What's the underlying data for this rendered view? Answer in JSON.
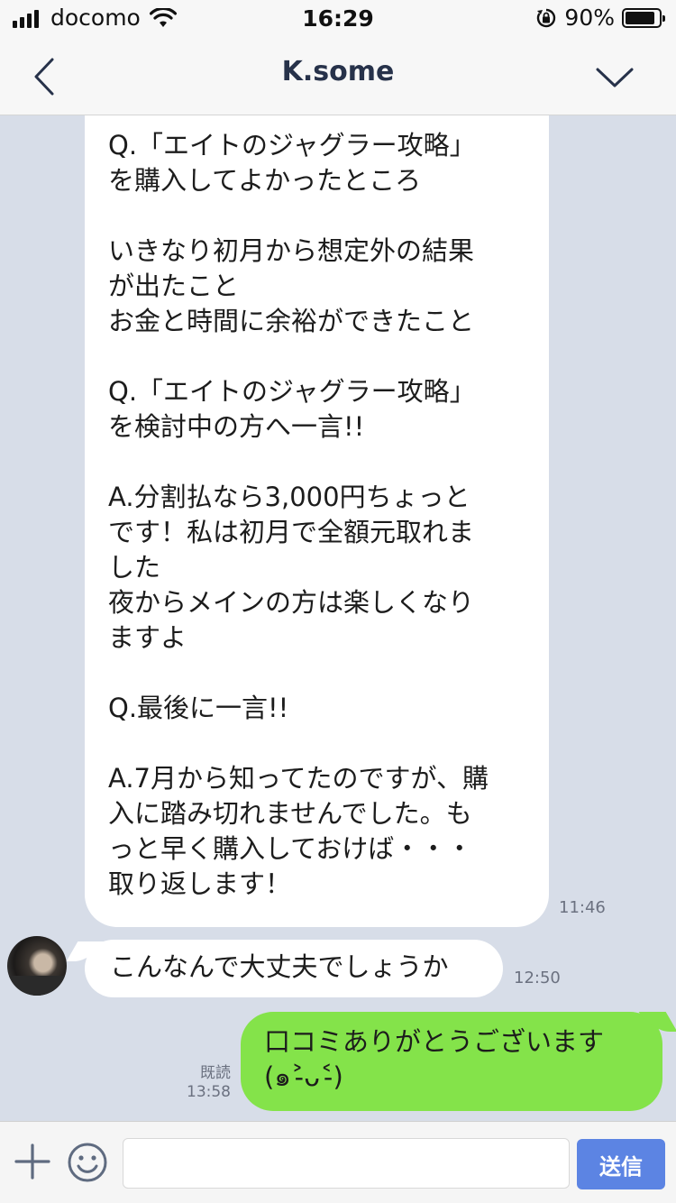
{
  "status_bar": {
    "carrier": "docomo",
    "time": "16:29",
    "battery_percent": "90%",
    "battery_level": 0.9,
    "icons": [
      "signal-icon",
      "wifi-icon",
      "orientation-lock-icon",
      "battery-icon"
    ]
  },
  "header": {
    "title": "K.some",
    "back_icon": "chevron-left-icon",
    "menu_icon": "chevron-down-icon"
  },
  "messages": [
    {
      "direction": "incoming",
      "text": "Q.「エイトのジャグラー攻略」\nを購入してよかったところ\n\nいきなり初月から想定外の結果\nが出たこと\nお金と時間に余裕ができたこと\n\nQ.「エイトのジャグラー攻略」\nを検討中の方へ一言!!\n\nA.分割払なら3,000円ちょっと\nです！私は初月で全額元取れま\nした\n夜からメインの方は楽しくなり\nますよ\n\nQ.最後に一言!!\n\nA.7月から知ってたのですが、購\n入に踏み切れませんでした。も\nっと早く購入しておけば・・・\n取り返します！",
      "time": "11:46"
    },
    {
      "direction": "incoming",
      "text": "こんなんで大丈夫でしょうか",
      "time": "12:50"
    },
    {
      "direction": "outgoing",
      "text_line1": "口コミありがとうございます",
      "text_line2": "(๑˃̵ᴗ˂̵)",
      "read_label": "既読",
      "time": "13:58"
    }
  ],
  "input_bar": {
    "placeholder": "",
    "send_label": "送信",
    "plus_icon": "plus-icon",
    "emoji_icon": "emoji-icon"
  },
  "colors": {
    "chat_background": "#d7dde8",
    "outgoing_bubble": "#84e34a",
    "send_button": "#5c84e3"
  }
}
